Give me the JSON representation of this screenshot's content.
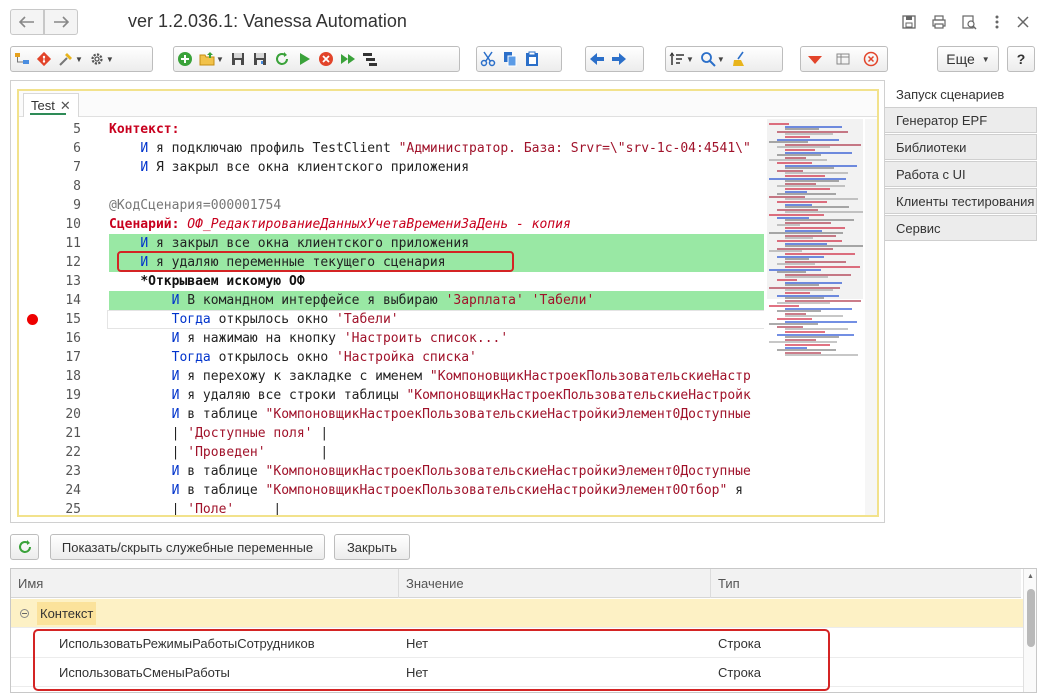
{
  "window": {
    "title": "ver 1.2.036.1: Vanessa Automation"
  },
  "toolbar": {
    "more_label": "Еще",
    "help_label": "?"
  },
  "editor": {
    "tab_label": "Test",
    "lines": [
      {
        "n": "5",
        "segs": [
          [
            "kw-red",
            "Контекст:"
          ]
        ]
      },
      {
        "n": "6",
        "segs": [
          [
            "normal",
            "    "
          ],
          [
            "kw-blue",
            "И"
          ],
          [
            "normal",
            " я подключаю профиль TestClient "
          ],
          [
            "str",
            "\"Администратор. База: Srvr=\\\"srv-1c-04:4541\\\""
          ]
        ]
      },
      {
        "n": "7",
        "segs": [
          [
            "normal",
            "    "
          ],
          [
            "kw-blue",
            "И"
          ],
          [
            "normal",
            " Я закрыл все окна клиентского приложения"
          ]
        ]
      },
      {
        "n": "8",
        "segs": []
      },
      {
        "n": "9",
        "segs": [
          [
            "comment",
            "@КодСценария=000001754"
          ]
        ]
      },
      {
        "n": "10",
        "segs": [
          [
            "kw-red",
            "Сценарий:"
          ],
          [
            "normal",
            " "
          ],
          [
            "italic-red",
            "ОФ_РедактированиеДанныхУчетаВремениЗаДень - копия"
          ]
        ]
      },
      {
        "n": "11",
        "segs": [
          [
            "normal",
            "    "
          ],
          [
            "kw-blue",
            "И"
          ],
          [
            "normal",
            " я закрыл все окна клиентского приложения"
          ]
        ],
        "hl": "green"
      },
      {
        "n": "12",
        "segs": [
          [
            "normal",
            "    "
          ],
          [
            "kw-blue",
            "И"
          ],
          [
            "normal",
            " я удаляю переменные текущего сценария"
          ]
        ],
        "hl": "green"
      },
      {
        "n": "13",
        "segs": [
          [
            "normal",
            "    "
          ],
          [
            "bold",
            "*Открываем искомую ОФ"
          ]
        ]
      },
      {
        "n": "14",
        "segs": [
          [
            "normal",
            "        "
          ],
          [
            "kw-blue",
            "И"
          ],
          [
            "normal",
            " В командном интерфейсе я выбираю "
          ],
          [
            "str",
            "'Зарплата'"
          ],
          [
            "normal",
            " "
          ],
          [
            "str",
            "'Табели'"
          ]
        ],
        "hl": "green"
      },
      {
        "n": "15",
        "segs": [
          [
            "normal",
            "        "
          ],
          [
            "kw-blue",
            "Тогда"
          ],
          [
            "normal",
            " открылось окно "
          ],
          [
            "str",
            "'Табели'"
          ]
        ],
        "hl": "current",
        "breakpoint": true
      },
      {
        "n": "16",
        "segs": [
          [
            "normal",
            "        "
          ],
          [
            "kw-blue",
            "И"
          ],
          [
            "normal",
            " я нажимаю на кнопку "
          ],
          [
            "str",
            "'Настроить список...'"
          ]
        ]
      },
      {
        "n": "17",
        "segs": [
          [
            "normal",
            "        "
          ],
          [
            "kw-blue",
            "Тогда"
          ],
          [
            "normal",
            " открылось окно "
          ],
          [
            "str",
            "'Настройка списка'"
          ]
        ]
      },
      {
        "n": "18",
        "segs": [
          [
            "normal",
            "        "
          ],
          [
            "kw-blue",
            "И"
          ],
          [
            "normal",
            " я перехожу к закладке с именем "
          ],
          [
            "str",
            "\"КомпоновщикНастроекПользовательскиеНастр"
          ]
        ]
      },
      {
        "n": "19",
        "segs": [
          [
            "normal",
            "        "
          ],
          [
            "kw-blue",
            "И"
          ],
          [
            "normal",
            " я удаляю все строки таблицы "
          ],
          [
            "str",
            "\"КомпоновщикНастроекПользовательскиеНастройк"
          ]
        ]
      },
      {
        "n": "20",
        "segs": [
          [
            "normal",
            "        "
          ],
          [
            "kw-blue",
            "И"
          ],
          [
            "normal",
            " в таблице "
          ],
          [
            "str",
            "\"КомпоновщикНастроекПользовательскиеНастройкиЭлемент0Доступные"
          ]
        ]
      },
      {
        "n": "21",
        "segs": [
          [
            "normal",
            "        | "
          ],
          [
            "str",
            "'Доступные поля'"
          ],
          [
            "normal",
            " |"
          ]
        ]
      },
      {
        "n": "22",
        "segs": [
          [
            "normal",
            "        | "
          ],
          [
            "str",
            "'Проведен'"
          ],
          [
            "normal",
            "       |"
          ]
        ]
      },
      {
        "n": "23",
        "segs": [
          [
            "normal",
            "        "
          ],
          [
            "kw-blue",
            "И"
          ],
          [
            "normal",
            " в таблице "
          ],
          [
            "str",
            "\"КомпоновщикНастроекПользовательскиеНастройкиЭлемент0Доступные"
          ]
        ]
      },
      {
        "n": "24",
        "segs": [
          [
            "normal",
            "        "
          ],
          [
            "kw-blue",
            "И"
          ],
          [
            "normal",
            " в таблице "
          ],
          [
            "str",
            "\"КомпоновщикНастроекПользовательскиеНастройкиЭлемент0Отбор\""
          ],
          [
            "normal",
            " я"
          ]
        ]
      },
      {
        "n": "25",
        "segs": [
          [
            "normal",
            "        | "
          ],
          [
            "str",
            "'Поле'"
          ],
          [
            "normal",
            "     |"
          ]
        ]
      }
    ]
  },
  "side_tabs": [
    {
      "label": "Запуск сценариев",
      "active": true
    },
    {
      "label": "Генератор EPF",
      "active": false
    },
    {
      "label": "Библиотеки",
      "active": false
    },
    {
      "label": "Работа с UI",
      "active": false
    },
    {
      "label": "Клиенты тестирования",
      "active": false
    },
    {
      "label": "Сервис",
      "active": false
    }
  ],
  "bottom_toolbar": {
    "toggle_label": "Показать/скрыть служебные переменные",
    "close_label": "Закрыть"
  },
  "variables_grid": {
    "columns": [
      "Имя",
      "Значение",
      "Тип"
    ],
    "group_label": "Контекст",
    "rows": [
      {
        "name": "ИспользоватьРежимыРаботыСотрудников",
        "value": "Нет",
        "type": "Строка"
      },
      {
        "name": "ИспользоватьСменыРаботы",
        "value": "Нет",
        "type": "Строка"
      }
    ]
  },
  "colors": {
    "highlight_green": "#99e8a4",
    "keyword_red": "#c8001e",
    "keyword_blue": "#0033cc",
    "string": "#a0122a",
    "annotation_red": "#d42424",
    "active_border": "#f2e28c"
  }
}
